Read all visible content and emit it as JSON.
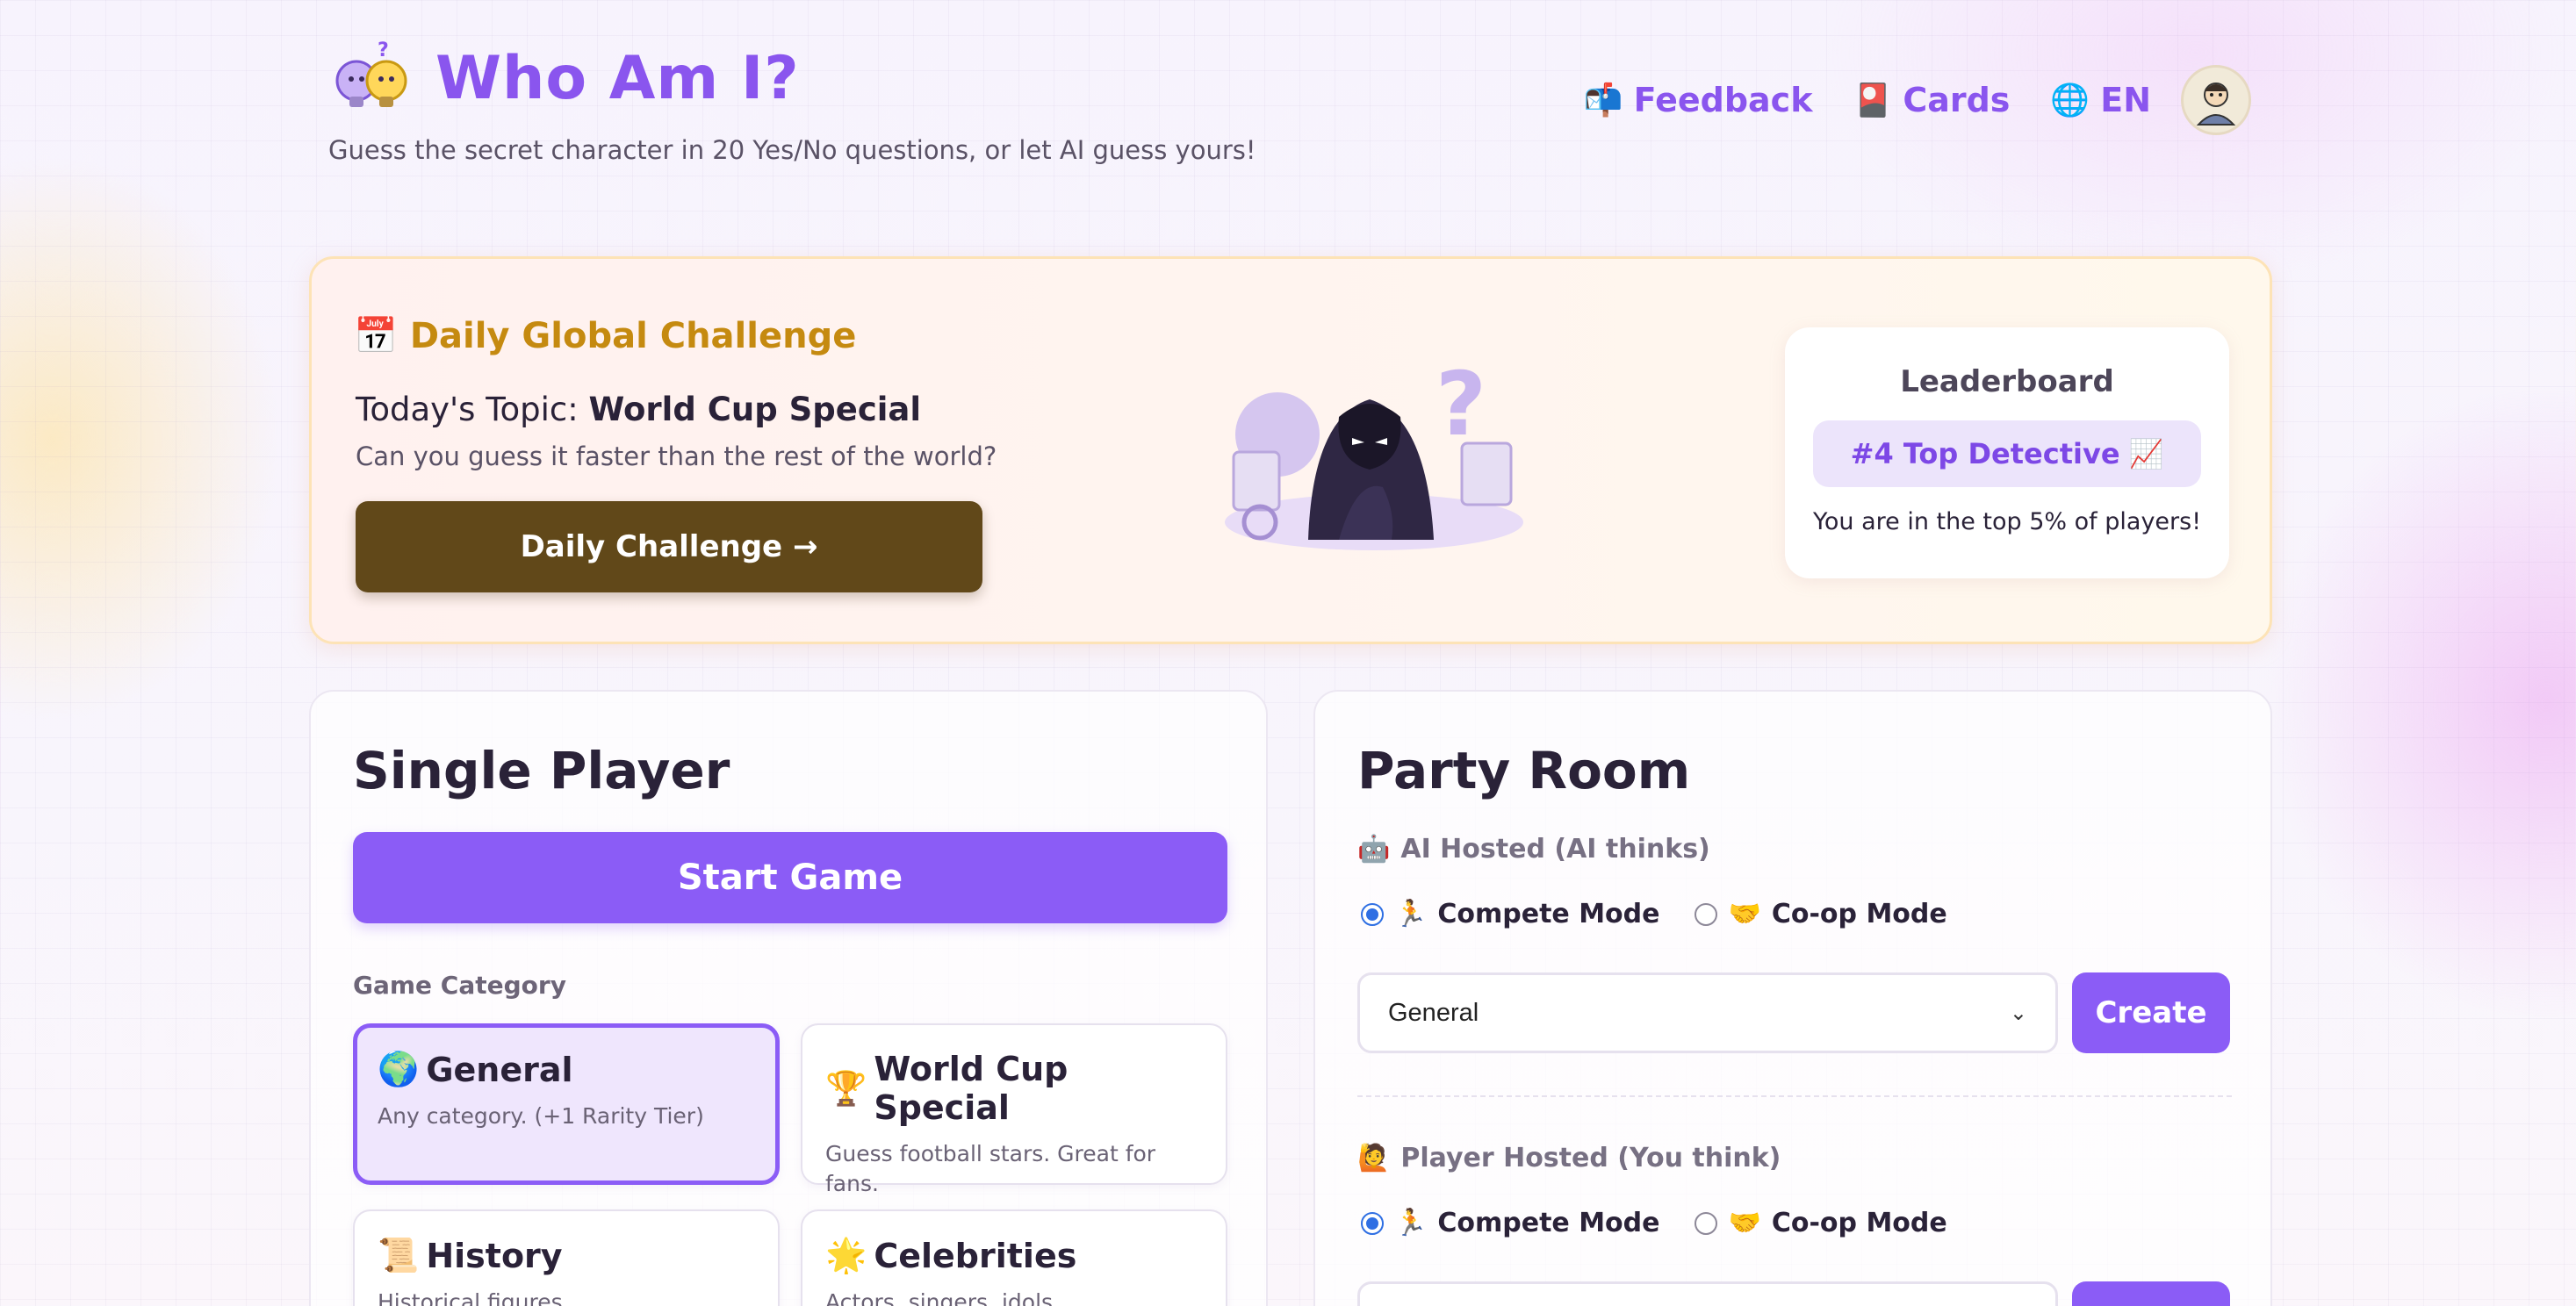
{
  "header": {
    "title": "Who Am I?",
    "subtitle": "Guess the secret character in 20 Yes/No questions, or let AI guess yours!",
    "nav": {
      "feedback": "Feedback",
      "cards": "Cards",
      "language": "EN"
    }
  },
  "daily": {
    "heading": "Daily Global Challenge",
    "topic_prefix": "Today's Topic:",
    "topic": "World Cup Special",
    "tagline": "Can you guess it faster than the rest of the world?",
    "button": "Daily Challenge →",
    "leaderboard": {
      "title": "Leaderboard",
      "badge": "#4 Top Detective",
      "note": "You are in the top 5% of players!"
    }
  },
  "single": {
    "title": "Single Player",
    "start": "Start Game",
    "category_label": "Game Category",
    "categories": [
      {
        "icon": "🌍",
        "title": "General",
        "desc": "Any category. (+1 Rarity Tier)",
        "selected": true
      },
      {
        "icon": "🏆",
        "title": "World Cup Special",
        "desc": "Guess football stars. Great for fans.",
        "selected": false
      },
      {
        "icon": "📜",
        "title": "History",
        "desc": "Historical figures",
        "selected": false
      },
      {
        "icon": "🌟",
        "title": "Celebrities",
        "desc": "Actors, singers, idols",
        "selected": false
      }
    ]
  },
  "party": {
    "title": "Party Room",
    "ai_hosted": "AI Hosted (AI thinks)",
    "player_hosted": "Player Hosted (You think)",
    "compete": "Compete Mode",
    "coop": "Co-op Mode",
    "select_value": "General",
    "create": "Create"
  },
  "colors": {
    "accent": "#8b5cf6",
    "daily_button": "#614819",
    "daily_heading": "#c58a10"
  }
}
